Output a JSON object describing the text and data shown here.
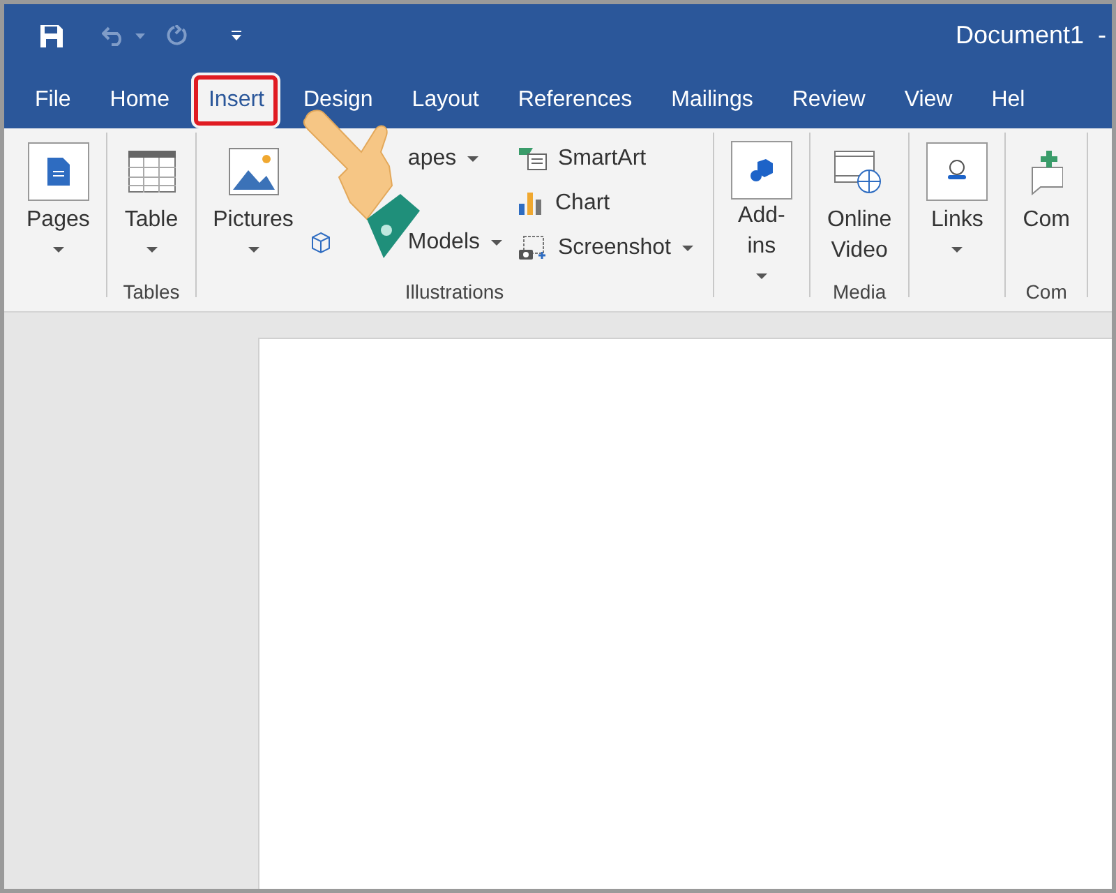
{
  "window": {
    "title": "Document1  -"
  },
  "tabs": [
    {
      "label": "File",
      "selected": false,
      "highlighted": false
    },
    {
      "label": "Home",
      "selected": false,
      "highlighted": false
    },
    {
      "label": "Insert",
      "selected": true,
      "highlighted": true
    },
    {
      "label": "Design",
      "selected": false,
      "highlighted": false
    },
    {
      "label": "Layout",
      "selected": false,
      "highlighted": false
    },
    {
      "label": "References",
      "selected": false,
      "highlighted": false
    },
    {
      "label": "Mailings",
      "selected": false,
      "highlighted": false
    },
    {
      "label": "Review",
      "selected": false,
      "highlighted": false
    },
    {
      "label": "View",
      "selected": false,
      "highlighted": false
    },
    {
      "label": "Hel",
      "selected": false,
      "highlighted": false
    }
  ],
  "ribbon": {
    "groups": [
      {
        "items": [
          {
            "kind": "large",
            "lines": [
              "Pages"
            ],
            "dropdown": true
          }
        ]
      },
      {
        "label": "Tables",
        "items": [
          {
            "kind": "large",
            "lines": [
              "Table"
            ],
            "dropdown": true
          }
        ]
      },
      {
        "label": "Illustrations",
        "items": [
          {
            "kind": "large",
            "lines": [
              "Pictures"
            ],
            "dropdown": true
          },
          {
            "kind": "pair",
            "label": "apes",
            "dropdown": true
          },
          {
            "kind": "pair",
            "label": "Models",
            "dropdown": true
          },
          {
            "kind": "small",
            "label": "SmartArt",
            "dropdown": false
          },
          {
            "kind": "small",
            "label": "Chart",
            "dropdown": false
          },
          {
            "kind": "small",
            "label": "Screenshot",
            "dropdown": true
          }
        ]
      },
      {
        "items": [
          {
            "kind": "large",
            "lines": [
              "Add-",
              "ins"
            ],
            "dropdown": true
          }
        ]
      },
      {
        "label": "Media",
        "items": [
          {
            "kind": "large",
            "lines": [
              "Online",
              "Video"
            ],
            "dropdown": false
          }
        ]
      },
      {
        "items": [
          {
            "kind": "large",
            "lines": [
              "Links"
            ],
            "dropdown": true
          }
        ]
      },
      {
        "label": "Com",
        "items": [
          {
            "kind": "large",
            "lines": [
              "Com"
            ],
            "dropdown": false
          }
        ]
      }
    ]
  }
}
